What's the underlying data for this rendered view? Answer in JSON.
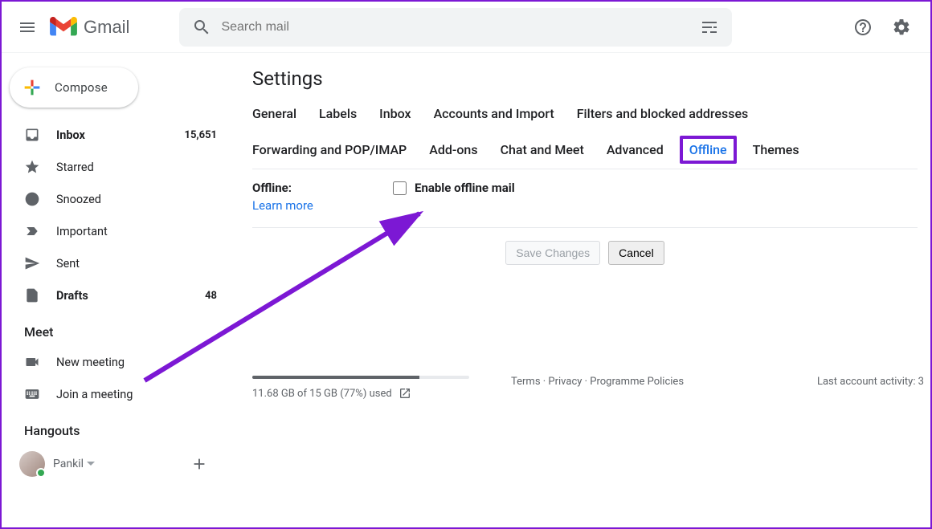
{
  "header": {
    "app_name": "Gmail",
    "search_placeholder": "Search mail"
  },
  "sidebar": {
    "compose_label": "Compose",
    "items": [
      {
        "icon": "inbox",
        "label": "Inbox",
        "count": "15,651",
        "bold": true
      },
      {
        "icon": "star",
        "label": "Starred",
        "count": ""
      },
      {
        "icon": "clock",
        "label": "Snoozed",
        "count": ""
      },
      {
        "icon": "important",
        "label": "Important",
        "count": ""
      },
      {
        "icon": "sent",
        "label": "Sent",
        "count": ""
      },
      {
        "icon": "drafts",
        "label": "Drafts",
        "count": "48",
        "bold": true
      }
    ],
    "meet_title": "Meet",
    "meet_items": [
      {
        "icon": "videocam",
        "label": "New meeting"
      },
      {
        "icon": "keyboard",
        "label": "Join a meeting"
      }
    ],
    "hangouts_title": "Hangouts",
    "hangouts_user": "Pankil"
  },
  "settings": {
    "page_title": "Settings",
    "tabs": [
      "General",
      "Labels",
      "Inbox",
      "Accounts and Import",
      "Filters and blocked addresses",
      "Forwarding and POP/IMAP",
      "Add-ons",
      "Chat and Meet",
      "Advanced",
      "Offline",
      "Themes"
    ],
    "active_tab": "Offline",
    "offline": {
      "label": "Offline:",
      "learn_more": "Learn more",
      "checkbox_label": "Enable offline mail",
      "checked": false
    },
    "save_label": "Save Changes",
    "cancel_label": "Cancel"
  },
  "footer": {
    "storage_text": "11.68 GB of 15 GB (77%) used",
    "storage_pct": 77,
    "terms": "Terms",
    "privacy": "Privacy",
    "policies": "Programme Policies",
    "activity": "Last account activity: 3"
  }
}
